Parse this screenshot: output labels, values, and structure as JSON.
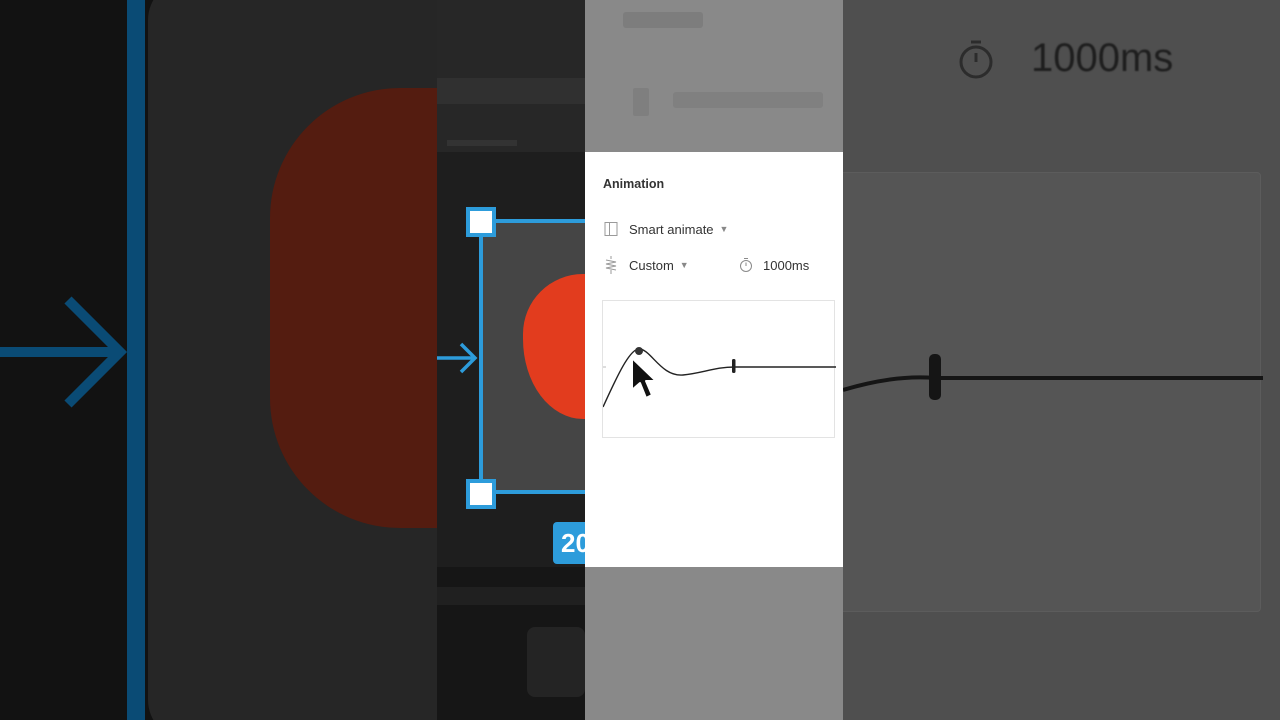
{
  "panel": {
    "title": "Animation",
    "transition": {
      "label": "Smart animate",
      "icon": "smart-animate-icon"
    },
    "easing": {
      "label": "Custom",
      "icon": "spring-icon"
    },
    "duration": {
      "value": "1000ms",
      "icon": "timer-icon"
    }
  },
  "canvas": {
    "size_badge": "20"
  },
  "background_right": {
    "duration_ghost": "1000ms"
  },
  "colors": {
    "selection": "#2d9cdb",
    "heart": "#e23c1e",
    "panel_bg": "#ffffff"
  }
}
